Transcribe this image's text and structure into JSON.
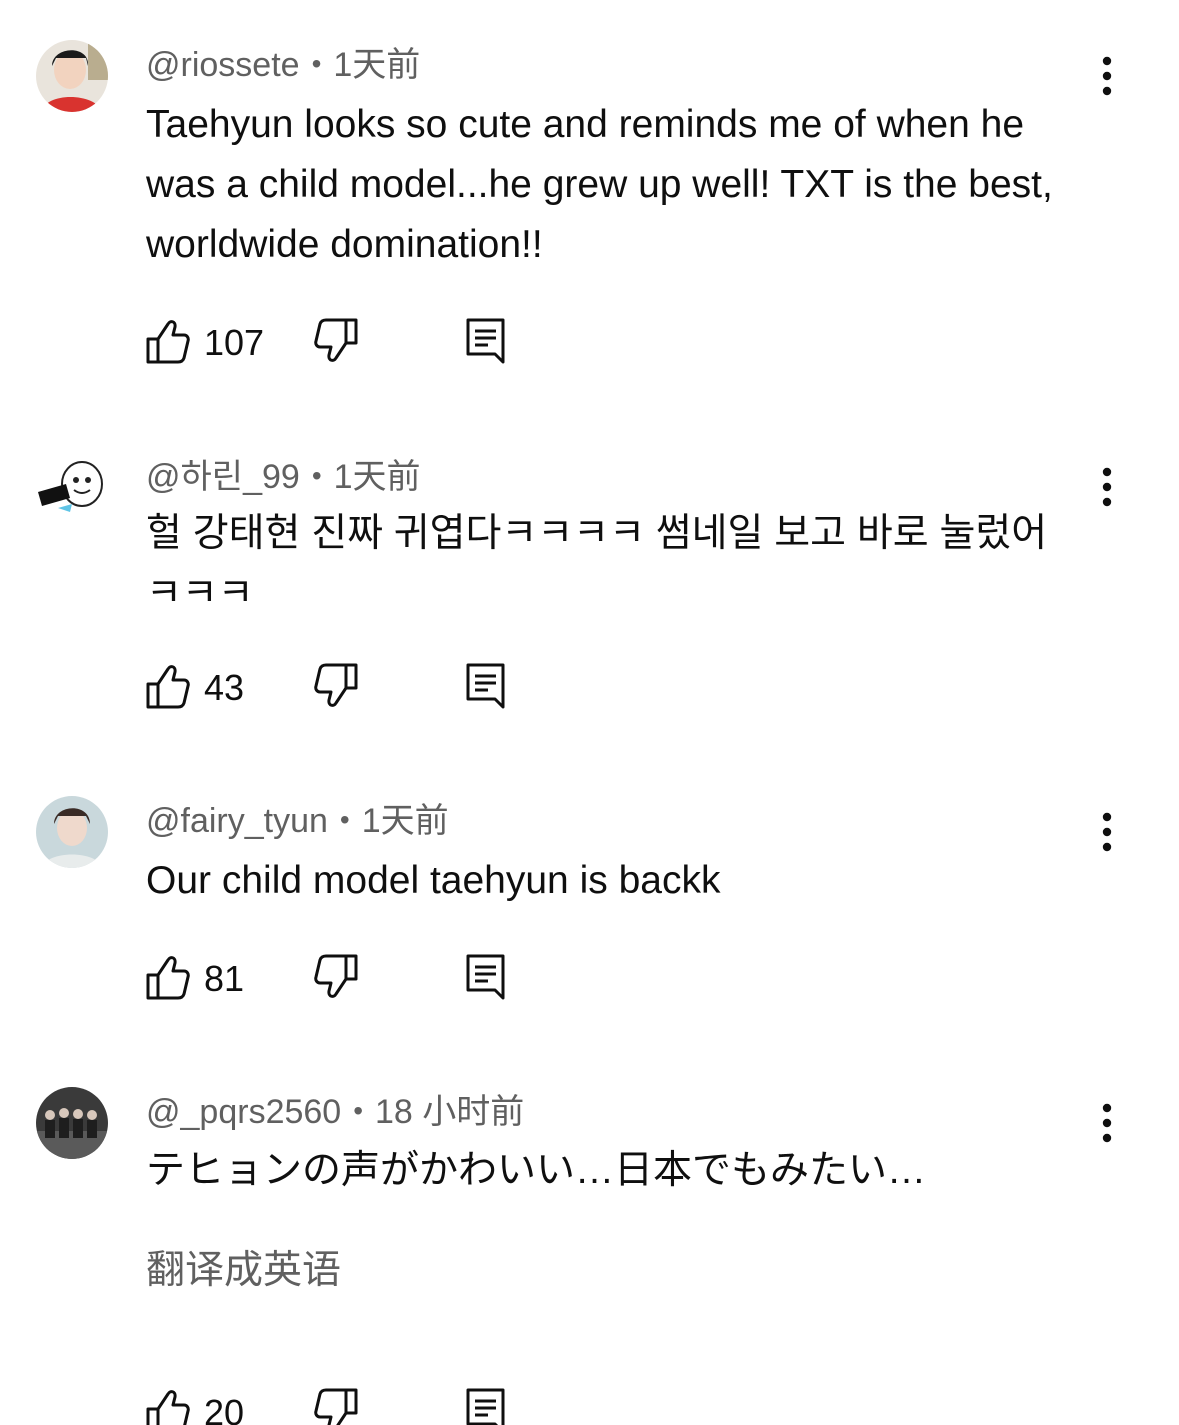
{
  "comments": [
    {
      "author": "@riossete",
      "time": "1天前",
      "text": "Taehyun looks so cute and reminds me of when he was a child model...he grew up well! TXT is the best, worldwide domination!!",
      "likes": "107",
      "avatar_color": "#d9332f"
    },
    {
      "author": "@하린_99",
      "time": "1天前",
      "text": "헐 강태현 진짜 귀엽다ㅋㅋㅋㅋ 썸네일 보고 바로 눌렀어ㅋㅋㅋ",
      "likes": "43",
      "avatar_color": "#ffffff"
    },
    {
      "author": "@fairy_tyun",
      "time": "1天前",
      "text": "Our child model taehyun is backk",
      "likes": "81",
      "avatar_color": "#c9d8dc"
    },
    {
      "author": "@_pqrs2560",
      "time": "18 小时前",
      "text": "テヒョンの声がかわいい…日本でもみたい…",
      "translate_label": "翻译成英语",
      "likes": "20",
      "avatar_color": "#3a3a3a"
    }
  ],
  "icons": {
    "like": "thumb-up-icon",
    "dislike": "thumb-down-icon",
    "reply": "reply-icon",
    "more": "more-vert-icon"
  },
  "colors": {
    "text_primary": "#0f0f0f",
    "text_secondary": "#606060",
    "background": "#ffffff"
  }
}
